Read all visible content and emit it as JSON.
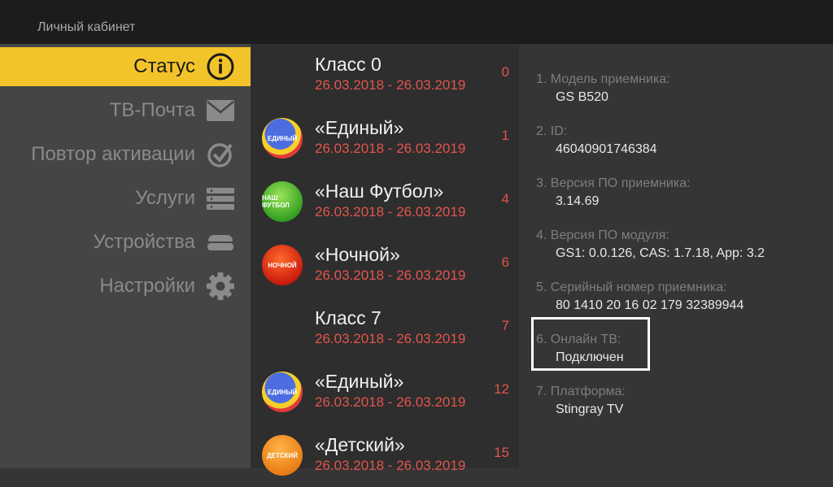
{
  "header": {
    "title": "Личный кабинет"
  },
  "sidebar": {
    "items": [
      {
        "label": "Статус",
        "icon": "info-icon",
        "active": true
      },
      {
        "label": "ТВ-Почта",
        "icon": "envelope-icon"
      },
      {
        "label": "Повтор активации",
        "icon": "check-circle-icon"
      },
      {
        "label": "Услуги",
        "icon": "list-icon"
      },
      {
        "label": "Устройства",
        "icon": "device-icon"
      },
      {
        "label": "Настройки",
        "icon": "gear-icon"
      }
    ]
  },
  "channels": [
    {
      "name": "Класс 0",
      "dates": "26.03.2018 - 26.03.2019",
      "number": "0",
      "logo": ""
    },
    {
      "name": "«Единый»",
      "dates": "26.03.2018 - 26.03.2019",
      "number": "1",
      "logo": "ЕДИНЫЙ"
    },
    {
      "name": "«Наш Футбол»",
      "dates": "26.03.2018 - 26.03.2019",
      "number": "4",
      "logo": "НАШ ФУТБОЛ"
    },
    {
      "name": "«Ночной»",
      "dates": "26.03.2018 - 26.03.2019",
      "number": "6",
      "logo": "НОЧНОЙ"
    },
    {
      "name": "Класс 7",
      "dates": "26.03.2018 - 26.03.2019",
      "number": "7",
      "logo": ""
    },
    {
      "name": "«Единый»",
      "dates": "26.03.2018 - 26.03.2019",
      "number": "12",
      "logo": "ЕДИНЫЙ"
    },
    {
      "name": "«Детский»",
      "dates": "26.03.2018 - 26.03.2019",
      "number": "15",
      "logo": "ДЕТСКИЙ"
    }
  ],
  "info": [
    {
      "label": "1. Модель приемника:",
      "value": "GS B520"
    },
    {
      "label": "2. ID:",
      "value": "46040901746384"
    },
    {
      "label": "3. Версия ПО приемника:",
      "value": "3.14.69"
    },
    {
      "label": "4. Версия ПО модуля:",
      "value": "GS1: 0.0.126, CAS: 1.7.18, App: 3.2"
    },
    {
      "label": "5. Серийный номер приемника:",
      "value": "80 1410 20 16 02 179 32389944"
    },
    {
      "label": "6. Онлайн ТВ:",
      "value": "Подключен"
    },
    {
      "label": "7. Платформа:",
      "value": "Stingray TV"
    }
  ],
  "colors": {
    "accent": "#f3c42a",
    "date": "#e2554c"
  }
}
